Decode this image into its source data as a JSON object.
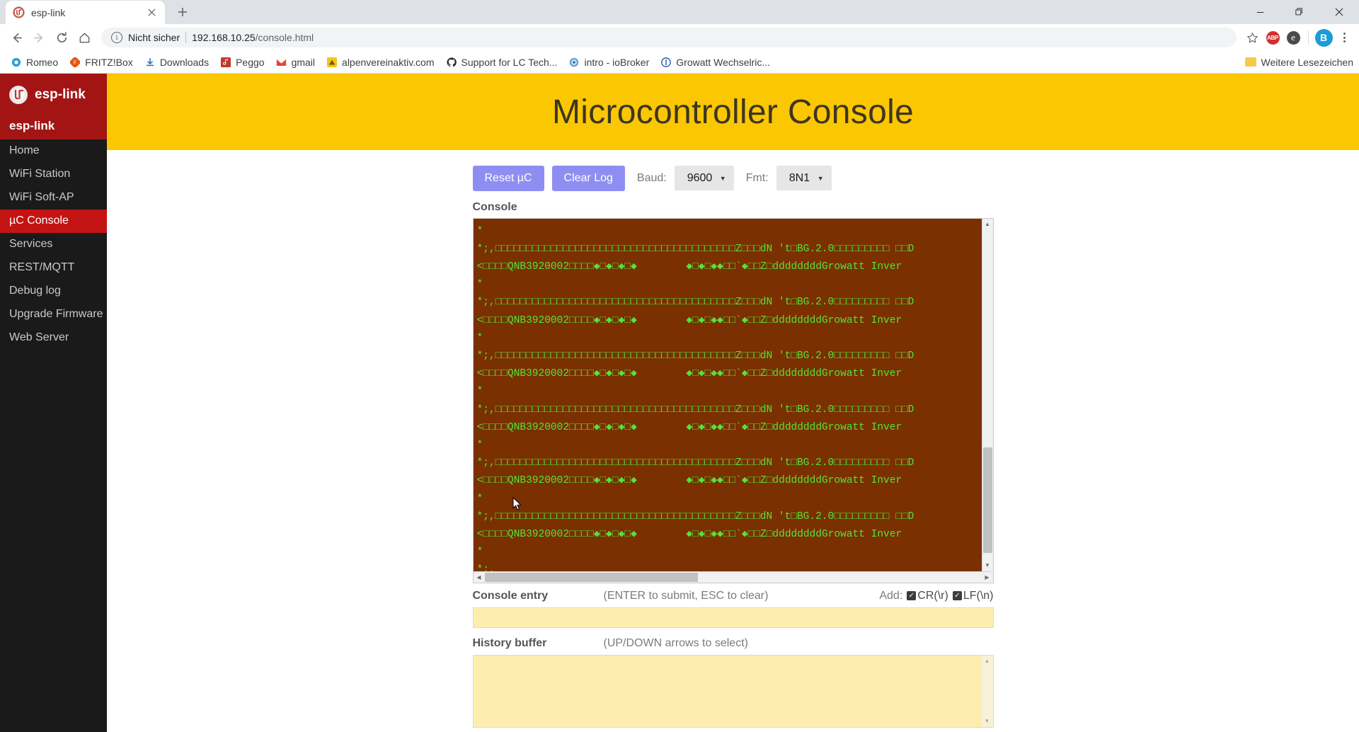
{
  "browser": {
    "tab": {
      "title": "esp-link",
      "favicon_icon": "esp-link-favicon",
      "close_icon": "close-icon"
    },
    "newtab_icon": "plus-icon",
    "window_controls": {
      "minimize_icon": "minimize-icon",
      "maximize_icon": "maximize-icon",
      "close_icon": "window-close-icon"
    },
    "nav": {
      "back_icon": "arrow-left-icon",
      "forward_icon": "arrow-right-icon",
      "reload_icon": "reload-icon",
      "home_icon": "home-icon"
    },
    "omnibox": {
      "info_icon": "info-circle-icon",
      "security_label": "Nicht sicher",
      "url_host": "192.168.10.25",
      "url_path": "/console.html"
    },
    "toolbar_right": {
      "bookmark_star_icon": "star-icon",
      "adblock_icon": "abp-icon",
      "adblock_label": "ABP",
      "edge_ext_icon": "e-extension-icon",
      "edge_ext_label": "e",
      "profile_icon": "profile-avatar",
      "profile_label": "B",
      "menu_icon": "kebab-menu-icon"
    },
    "bookmarks": [
      {
        "label": "Romeo",
        "icon": "romeo-favicon"
      },
      {
        "label": "FRITZ!Box",
        "icon": "fritzbox-favicon"
      },
      {
        "label": "Downloads",
        "icon": "download-icon"
      },
      {
        "label": "Peggo",
        "icon": "peggo-favicon"
      },
      {
        "label": "gmail",
        "icon": "gmail-favicon"
      },
      {
        "label": "alpenvereinaktiv.com",
        "icon": "alpenverein-favicon"
      },
      {
        "label": "Support for LC Tech...",
        "icon": "github-favicon"
      },
      {
        "label": "intro - ioBroker",
        "icon": "iobroker-favicon"
      },
      {
        "label": "Growatt Wechselric...",
        "icon": "growatt-favicon"
      }
    ],
    "bookmarks_overflow": {
      "label": "Weitere Lesezeichen",
      "icon": "folder-icon"
    }
  },
  "sidebar": {
    "brand": {
      "name": "esp-link",
      "logo_icon": "esp-link-logo"
    },
    "nav_header": "esp-link",
    "items": [
      {
        "label": "Home",
        "active": false
      },
      {
        "label": "WiFi Station",
        "active": false
      },
      {
        "label": "WiFi Soft-AP",
        "active": false
      },
      {
        "label": "µC Console",
        "active": true
      },
      {
        "label": "Services",
        "active": false
      },
      {
        "label": "REST/MQTT",
        "active": false
      },
      {
        "label": "Debug log",
        "active": false
      },
      {
        "label": "Upgrade Firmware",
        "active": false
      },
      {
        "label": "Web Server",
        "active": false
      }
    ]
  },
  "main": {
    "banner_title": "Microcontroller Console",
    "controls": {
      "reset_button": "Reset µC",
      "clear_button": "Clear Log",
      "baud_label": "Baud:",
      "baud_value": "9600",
      "fmt_label": "Fmt:",
      "fmt_value": "8N1",
      "dropdown_icon": "chevron-down-icon"
    },
    "console_label": "Console",
    "console_text": "*\n*;,□□□□□□□□□□□□□□□□□□□□□□□□□□□□□□□□□□□□□□□Z□□□dN 't□BG.2.0□□□□□□□□□ □□D\n<□□□□QNB3920002□□□□◆□◆□◆□◆        ◆□◆□◆◆□□`◆□□Z□ddddddddGrowatt Inver\n*\n*;,□□□□□□□□□□□□□□□□□□□□□□□□□□□□□□□□□□□□□□□Z□□□dN 't□BG.2.0□□□□□□□□□ □□D\n<□□□□QNB3920002□□□□◆□◆□◆□◆        ◆□◆□◆◆□□`◆□□Z□ddddddddGrowatt Inver\n*\n*;,□□□□□□□□□□□□□□□□□□□□□□□□□□□□□□□□□□□□□□□Z□□□dN 't□BG.2.0□□□□□□□□□ □□D\n<□□□□QNB3920002□□□□◆□◆□◆□◆        ◆□◆□◆◆□□`◆□□Z□ddddddddGrowatt Inver\n*\n*;,□□□□□□□□□□□□□□□□□□□□□□□□□□□□□□□□□□□□□□□Z□□□dN 't□BG.2.0□□□□□□□□□ □□D\n<□□□□QNB3920002□□□□◆□◆□◆□◆        ◆□◆□◆◆□□`◆□□Z□ddddddddGrowatt Inver\n*\n*;,□□□□□□□□□□□□□□□□□□□□□□□□□□□□□□□□□□□□□□□Z□□□dN 't□BG.2.0□□□□□□□□□ □□D\n<□□□□QNB3920002□□□□◆□◆□◆□◆        ◆□◆□◆◆□□`◆□□Z□ddddddddGrowatt Inver\n*\n*;,□□□□□□□□□□□□□□□□□□□□□□□□□□□□□□□□□□□□□□□Z□□□dN 't□BG.2.0□□□□□□□□□ □□D\n<□□□□QNB3920002□□□□◆□◆□◆□◆        ◆□◆□◆◆□□`◆□□Z□ddddddddGrowatt Inver\n*\n*;,",
    "console_entry": {
      "label": "Console entry",
      "hint": "(ENTER to submit, ESC to clear)",
      "add_label": "Add:",
      "cr_label": "CR(\\r)",
      "lf_label": "LF(\\n)",
      "cr_checked": true,
      "lf_checked": true,
      "value": ""
    },
    "history_buffer": {
      "label": "History buffer",
      "hint": "(UP/DOWN arrows to select)",
      "value": ""
    },
    "scroll_icons": {
      "up": "scroll-up-arrow",
      "down": "scroll-down-arrow",
      "left": "scroll-left-arrow",
      "right": "scroll-right-arrow"
    }
  },
  "colors": {
    "banner_bg": "#fbc700",
    "sidebar_bg": "#1a1a1a",
    "brand_bg": "#a31515",
    "active_nav_bg": "#c41313",
    "console_bg": "#7a3000",
    "console_fg": "#55e33a",
    "button_bg": "#8e8ef2",
    "field_bg": "#fdeeaf"
  }
}
